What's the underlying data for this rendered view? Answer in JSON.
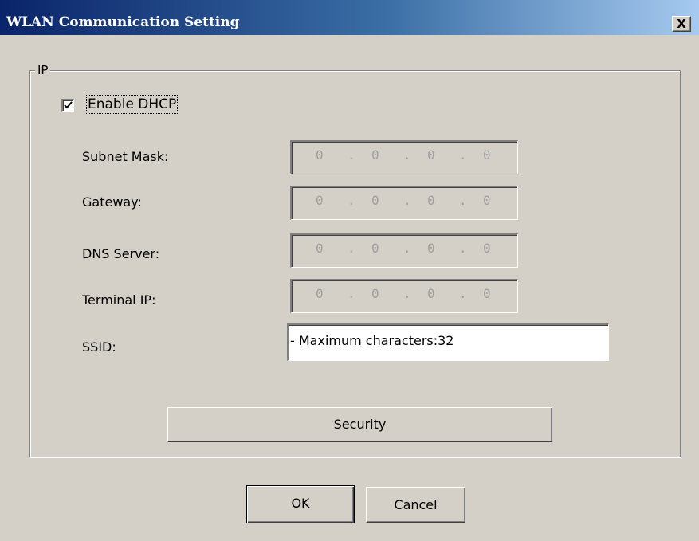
{
  "window": {
    "title": "WLAN Communication Setting",
    "close_label": "X"
  },
  "group": {
    "legend": "IP"
  },
  "dhcp": {
    "label": "Enable DHCP",
    "checked": true
  },
  "fields": [
    {
      "label": "Subnet Mask:",
      "octets": [
        "0",
        "0",
        "0",
        "0"
      ],
      "enabled": false
    },
    {
      "label": "Gateway:",
      "octets": [
        "0",
        "0",
        "0",
        "0"
      ],
      "enabled": false
    },
    {
      "label": "DNS Server:",
      "octets": [
        "0",
        "0",
        "0",
        "0"
      ],
      "enabled": false
    },
    {
      "label": "Terminal IP:",
      "octets": [
        "0",
        "0",
        "0",
        "0"
      ],
      "enabled": false
    }
  ],
  "ssid": {
    "label": "SSID:",
    "value": "- Maximum characters:32"
  },
  "buttons": {
    "security": "Security",
    "ok": "OK",
    "cancel": "Cancel"
  },
  "colors": {
    "title_start": "#0a246a",
    "title_end": "#a6caf0",
    "face": "#d4d0c8"
  }
}
